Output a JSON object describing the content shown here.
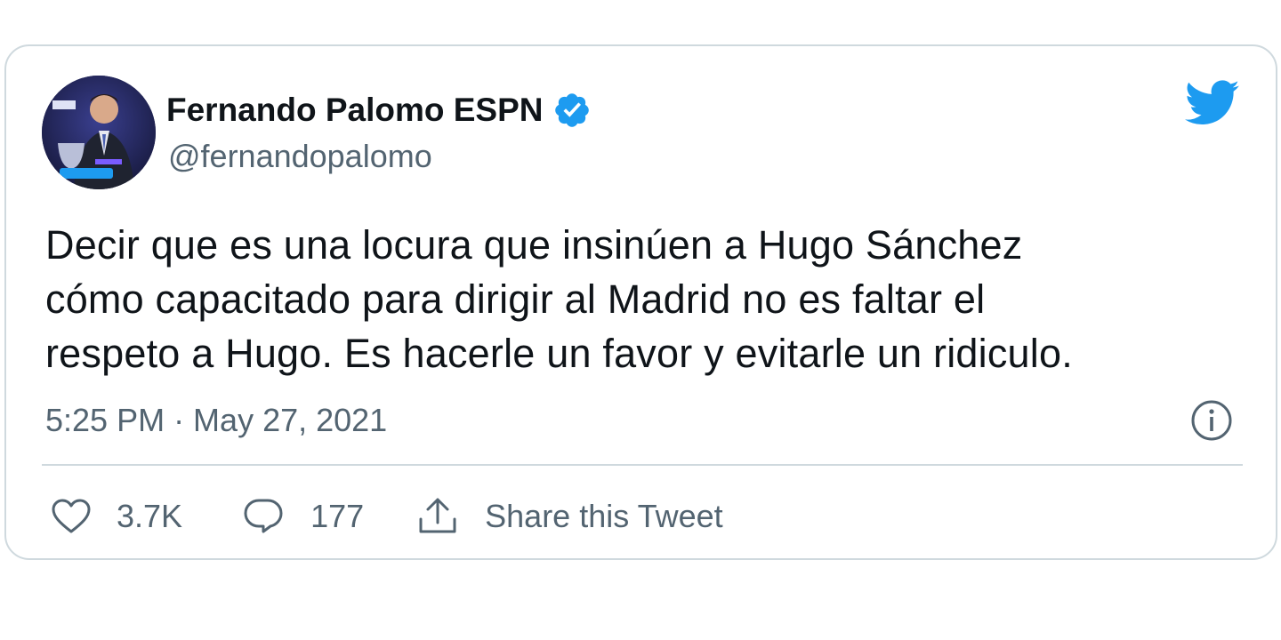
{
  "tweet": {
    "author_name": "Fernando Palomo ESPN",
    "handle": "@fernandopalomo",
    "text": "Decir que es una locura que insinúen a Hugo Sánchez\ncómo capacitado para dirigir al Madrid no es faltar el\nrespeto a Hugo. Es hacerle un favor y evitarle un ridiculo.",
    "timestamp": "5:25 PM · May 27, 2021"
  },
  "actions": {
    "like_count": "3.7K",
    "reply_count": "177",
    "share_label": "Share this Tweet"
  },
  "icons": {
    "brand": "twitter-bird-icon",
    "verified": "verified-badge-icon",
    "info": "info-icon",
    "like": "heart-icon",
    "reply": "reply-bubble-icon",
    "share": "share-icon"
  },
  "colors": {
    "brand_blue": "#1d9bf0",
    "text": "#0f1419",
    "secondary_text": "#536471",
    "border": "#cfd9de"
  }
}
